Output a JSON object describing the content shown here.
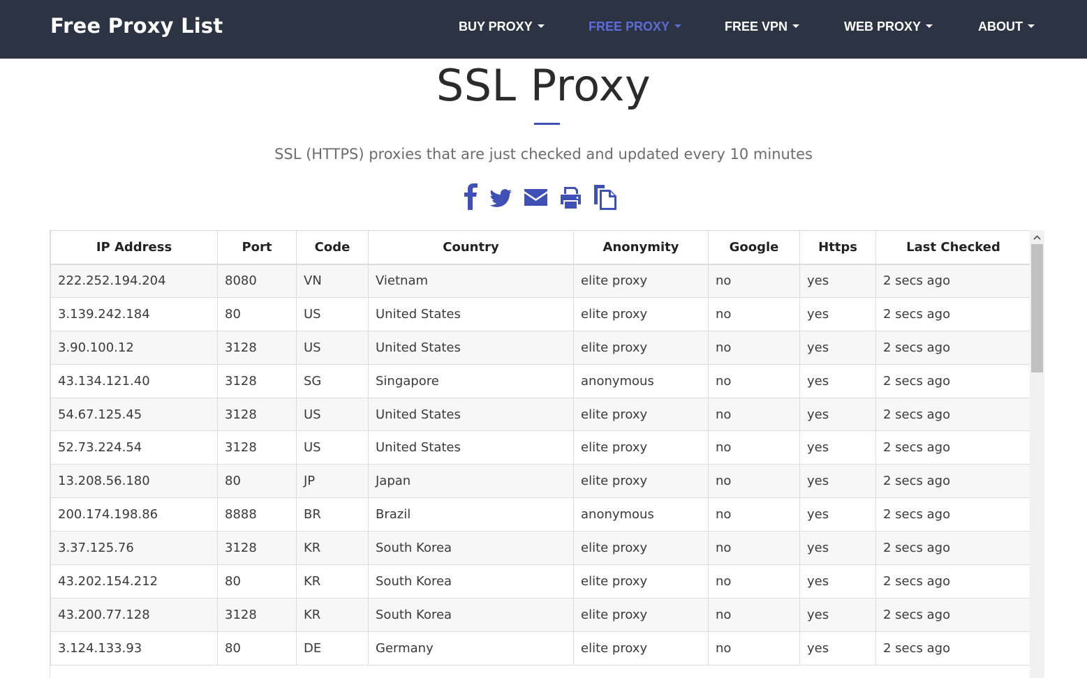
{
  "navbar": {
    "brand": "Free Proxy List",
    "items": [
      {
        "label": "BUY PROXY"
      },
      {
        "label": "FREE PROXY",
        "active": true
      },
      {
        "label": "FREE VPN"
      },
      {
        "label": "WEB PROXY"
      },
      {
        "label": "ABOUT"
      }
    ]
  },
  "hero": {
    "title": "SSL Proxy",
    "subtitle": "SSL (HTTPS) proxies that are just checked and updated every 10 minutes"
  },
  "share_icons": [
    "facebook-icon",
    "twitter-icon",
    "email-icon",
    "print-icon",
    "copy-icon"
  ],
  "colors": {
    "navbar_bg": "#2c3444",
    "accent": "#3f51b5",
    "nav_active": "#5f6bd6"
  },
  "table": {
    "columns": [
      "IP Address",
      "Port",
      "Code",
      "Country",
      "Anonymity",
      "Google",
      "Https",
      "Last Checked"
    ],
    "rows": [
      [
        "222.252.194.204",
        "8080",
        "VN",
        "Vietnam",
        "elite proxy",
        "no",
        "yes",
        "2 secs ago"
      ],
      [
        "3.139.242.184",
        "80",
        "US",
        "United States",
        "elite proxy",
        "no",
        "yes",
        "2 secs ago"
      ],
      [
        "3.90.100.12",
        "3128",
        "US",
        "United States",
        "elite proxy",
        "no",
        "yes",
        "2 secs ago"
      ],
      [
        "43.134.121.40",
        "3128",
        "SG",
        "Singapore",
        "anonymous",
        "no",
        "yes",
        "2 secs ago"
      ],
      [
        "54.67.125.45",
        "3128",
        "US",
        "United States",
        "elite proxy",
        "no",
        "yes",
        "2 secs ago"
      ],
      [
        "52.73.224.54",
        "3128",
        "US",
        "United States",
        "elite proxy",
        "no",
        "yes",
        "2 secs ago"
      ],
      [
        "13.208.56.180",
        "80",
        "JP",
        "Japan",
        "elite proxy",
        "no",
        "yes",
        "2 secs ago"
      ],
      [
        "200.174.198.86",
        "8888",
        "BR",
        "Brazil",
        "anonymous",
        "no",
        "yes",
        "2 secs ago"
      ],
      [
        "3.37.125.76",
        "3128",
        "KR",
        "South Korea",
        "elite proxy",
        "no",
        "yes",
        "2 secs ago"
      ],
      [
        "43.202.154.212",
        "80",
        "KR",
        "South Korea",
        "elite proxy",
        "no",
        "yes",
        "2 secs ago"
      ],
      [
        "43.200.77.128",
        "3128",
        "KR",
        "South Korea",
        "elite proxy",
        "no",
        "yes",
        "2 secs ago"
      ],
      [
        "3.124.133.93",
        "80",
        "DE",
        "Germany",
        "elite proxy",
        "no",
        "yes",
        "2 secs ago"
      ]
    ]
  }
}
